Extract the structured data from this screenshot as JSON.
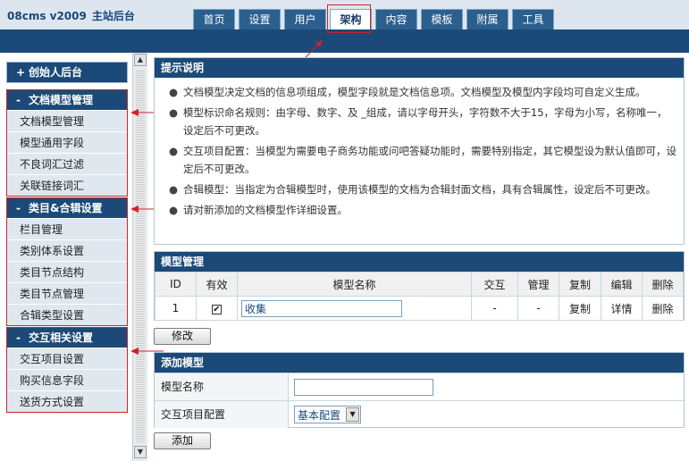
{
  "brand": {
    "name": "08cms v2009",
    "subtitle": "主站后台"
  },
  "tabs": [
    "首页",
    "设置",
    "用户",
    "架构",
    "内容",
    "模板",
    "附属",
    "工具"
  ],
  "sidebar": {
    "creator": {
      "symbol": "+",
      "label": "创始人后台"
    },
    "groups": [
      {
        "symbol": "-",
        "label": "文档模型管理",
        "items": [
          "文档模型管理",
          "模型通用字段",
          "不良词汇过滤",
          "关联链接词汇"
        ]
      },
      {
        "symbol": "-",
        "label": "类目&合辑设置",
        "items": [
          "栏目管理",
          "类别体系设置",
          "类目节点结构",
          "类目节点管理",
          "合辑类型设置"
        ]
      },
      {
        "symbol": "-",
        "label": "交互相关设置",
        "items": [
          "交互项目设置",
          "购买信息字段",
          "送货方式设置"
        ]
      }
    ]
  },
  "tips": {
    "title": "提示说明",
    "items": [
      "文档模型决定文档的信息项组成，模型字段就是文档信息项。文档模型及模型内字段均可自定义生成。",
      "模型标识命名规则：由字母、数字、及 _组成，请以字母开头，字符数不大于15，字母为小写，名称唯一，设定后不可更改。",
      "交互项目配置：当模型为需要电子商务功能或问吧答疑功能时，需要特别指定，其它模型设为默认值即可，设定后不可更改。",
      "合辑模型：当指定为合辑模型时，使用该模型的文档为合辑封面文档，具有合辑属性，设定后不可更改。",
      "请对新添加的文档模型作详细设置。"
    ]
  },
  "models": {
    "title": "模型管理",
    "columns": [
      "ID",
      "有效",
      "模型名称",
      "交互",
      "管理",
      "复制",
      "编辑",
      "删除"
    ],
    "rows": [
      {
        "id": "1",
        "valid": "✔",
        "name": "收集",
        "interaction": "-",
        "manage": "-",
        "copy": "复制",
        "edit": "详情",
        "delete": "删除"
      }
    ]
  },
  "modify_button": "修改",
  "add_model": {
    "title": "添加模型",
    "name_label": "模型名称",
    "name_value": "",
    "config_label": "交互项目配置",
    "config_value": "基本配置"
  },
  "add_button": "添加",
  "colors": {
    "header_blue": "#1b4a78",
    "highlight_red": "#d0202a",
    "sidebar_item": "#dfe7ef"
  }
}
